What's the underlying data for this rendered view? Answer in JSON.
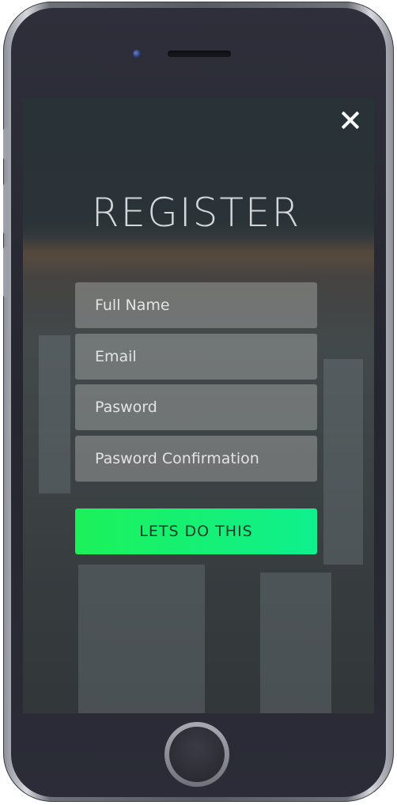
{
  "device": {
    "type": "smartphone"
  },
  "screen": {
    "close_icon": "close-icon",
    "title": "REGISTER",
    "fields": {
      "full_name_placeholder": "Full Name",
      "email_placeholder": "Email",
      "password_placeholder": "Pasword",
      "password_confirmation_placeholder": "Pasword Confirmation"
    },
    "submit_label": "LETS DO THIS",
    "colors": {
      "submit_gradient_start": "#1cf15a",
      "submit_gradient_end": "#0ff08e",
      "title": "#d4d7d9"
    }
  }
}
